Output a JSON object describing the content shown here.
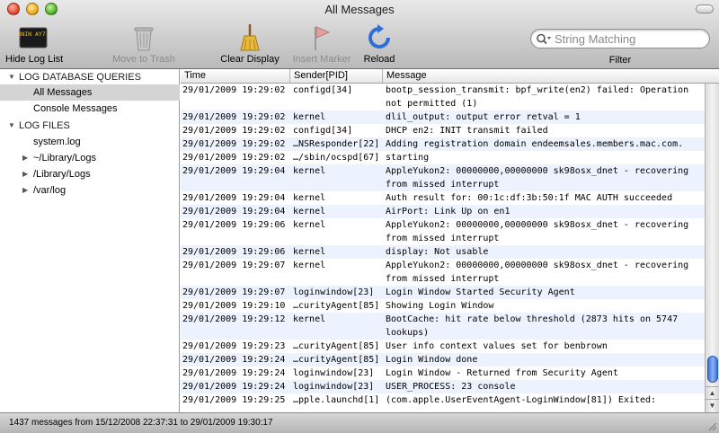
{
  "window": {
    "title": "All Messages"
  },
  "toolbar": {
    "hide_log_list": "Hide Log List",
    "hide_log_list_icon_text": "WARNIN AY7:36",
    "move_to_trash": "Move to Trash",
    "clear_display": "Clear Display",
    "insert_marker": "Insert Marker",
    "reload": "Reload",
    "search_placeholder": "String Matching",
    "filter_label": "Filter"
  },
  "sidebar": {
    "log_db_queries": "LOG DATABASE QUERIES",
    "all_messages": "All Messages",
    "console_messages": "Console Messages",
    "log_files": "LOG FILES",
    "system_log": "system.log",
    "user_library_logs": "~/Library/Logs",
    "library_logs": "/Library/Logs",
    "var_log": "/var/log"
  },
  "columns": {
    "time": "Time",
    "sender": "Sender[PID]",
    "message": "Message"
  },
  "rows": [
    {
      "time": "29/01/2009 19:29:02",
      "sender": "configd[34]",
      "message": "bootp_session_transmit: bpf_write(en2) failed: Operation not permitted (1)"
    },
    {
      "time": "29/01/2009 19:29:02",
      "sender": "kernel",
      "message": "dlil_output: output error retval = 1"
    },
    {
      "time": "29/01/2009 19:29:02",
      "sender": "configd[34]",
      "message": "DHCP en2: INIT transmit failed"
    },
    {
      "time": "29/01/2009 19:29:02",
      "sender": "…NSResponder[22]",
      "message": "Adding registration domain endeemsales.members.mac.com."
    },
    {
      "time": "29/01/2009 19:29:02",
      "sender": "…/sbin/ocspd[67]",
      "message": "starting"
    },
    {
      "time": "29/01/2009 19:29:04",
      "sender": "kernel",
      "message": "AppleYukon2: 00000000,00000000 sk98osx_dnet - recovering from missed interrupt"
    },
    {
      "time": "29/01/2009 19:29:04",
      "sender": "kernel",
      "message": "Auth result for: 00:1c:df:3b:50:1f MAC AUTH succeeded"
    },
    {
      "time": "29/01/2009 19:29:04",
      "sender": "kernel",
      "message": "AirPort: Link Up on en1"
    },
    {
      "time": "29/01/2009 19:29:06",
      "sender": "kernel",
      "message": "AppleYukon2: 00000000,00000000 sk98osx_dnet - recovering from missed interrupt"
    },
    {
      "time": "29/01/2009 19:29:06",
      "sender": "kernel",
      "message": "display: Not usable"
    },
    {
      "time": "29/01/2009 19:29:07",
      "sender": "kernel",
      "message": "AppleYukon2: 00000000,00000000 sk98osx_dnet - recovering from missed interrupt"
    },
    {
      "time": "29/01/2009 19:29:07",
      "sender": "loginwindow[23]",
      "message": "Login Window Started Security Agent"
    },
    {
      "time": "29/01/2009 19:29:10",
      "sender": "…curityAgent[85]",
      "message": "Showing Login Window"
    },
    {
      "time": "29/01/2009 19:29:12",
      "sender": "kernel",
      "message": "BootCache: hit rate below threshold (2873 hits on 5747 lookups)"
    },
    {
      "time": "29/01/2009 19:29:23",
      "sender": "…curityAgent[85]",
      "message": "User info context values set for benbrown"
    },
    {
      "time": "29/01/2009 19:29:24",
      "sender": "…curityAgent[85]",
      "message": "Login Window done"
    },
    {
      "time": "29/01/2009 19:29:24",
      "sender": "loginwindow[23]",
      "message": "Login Window - Returned from Security Agent"
    },
    {
      "time": "29/01/2009 19:29:24",
      "sender": "loginwindow[23]",
      "message": "USER_PROCESS: 23 console"
    },
    {
      "time": "29/01/2009 19:29:25",
      "sender": "…pple.launchd[1]",
      "message": "(com.apple.UserEventAgent-LoginWindow[81]) Exited:"
    }
  ],
  "status": {
    "text": "1437 messages from 15/12/2008 22:37:31 to 29/01/2009 19:30:17"
  }
}
